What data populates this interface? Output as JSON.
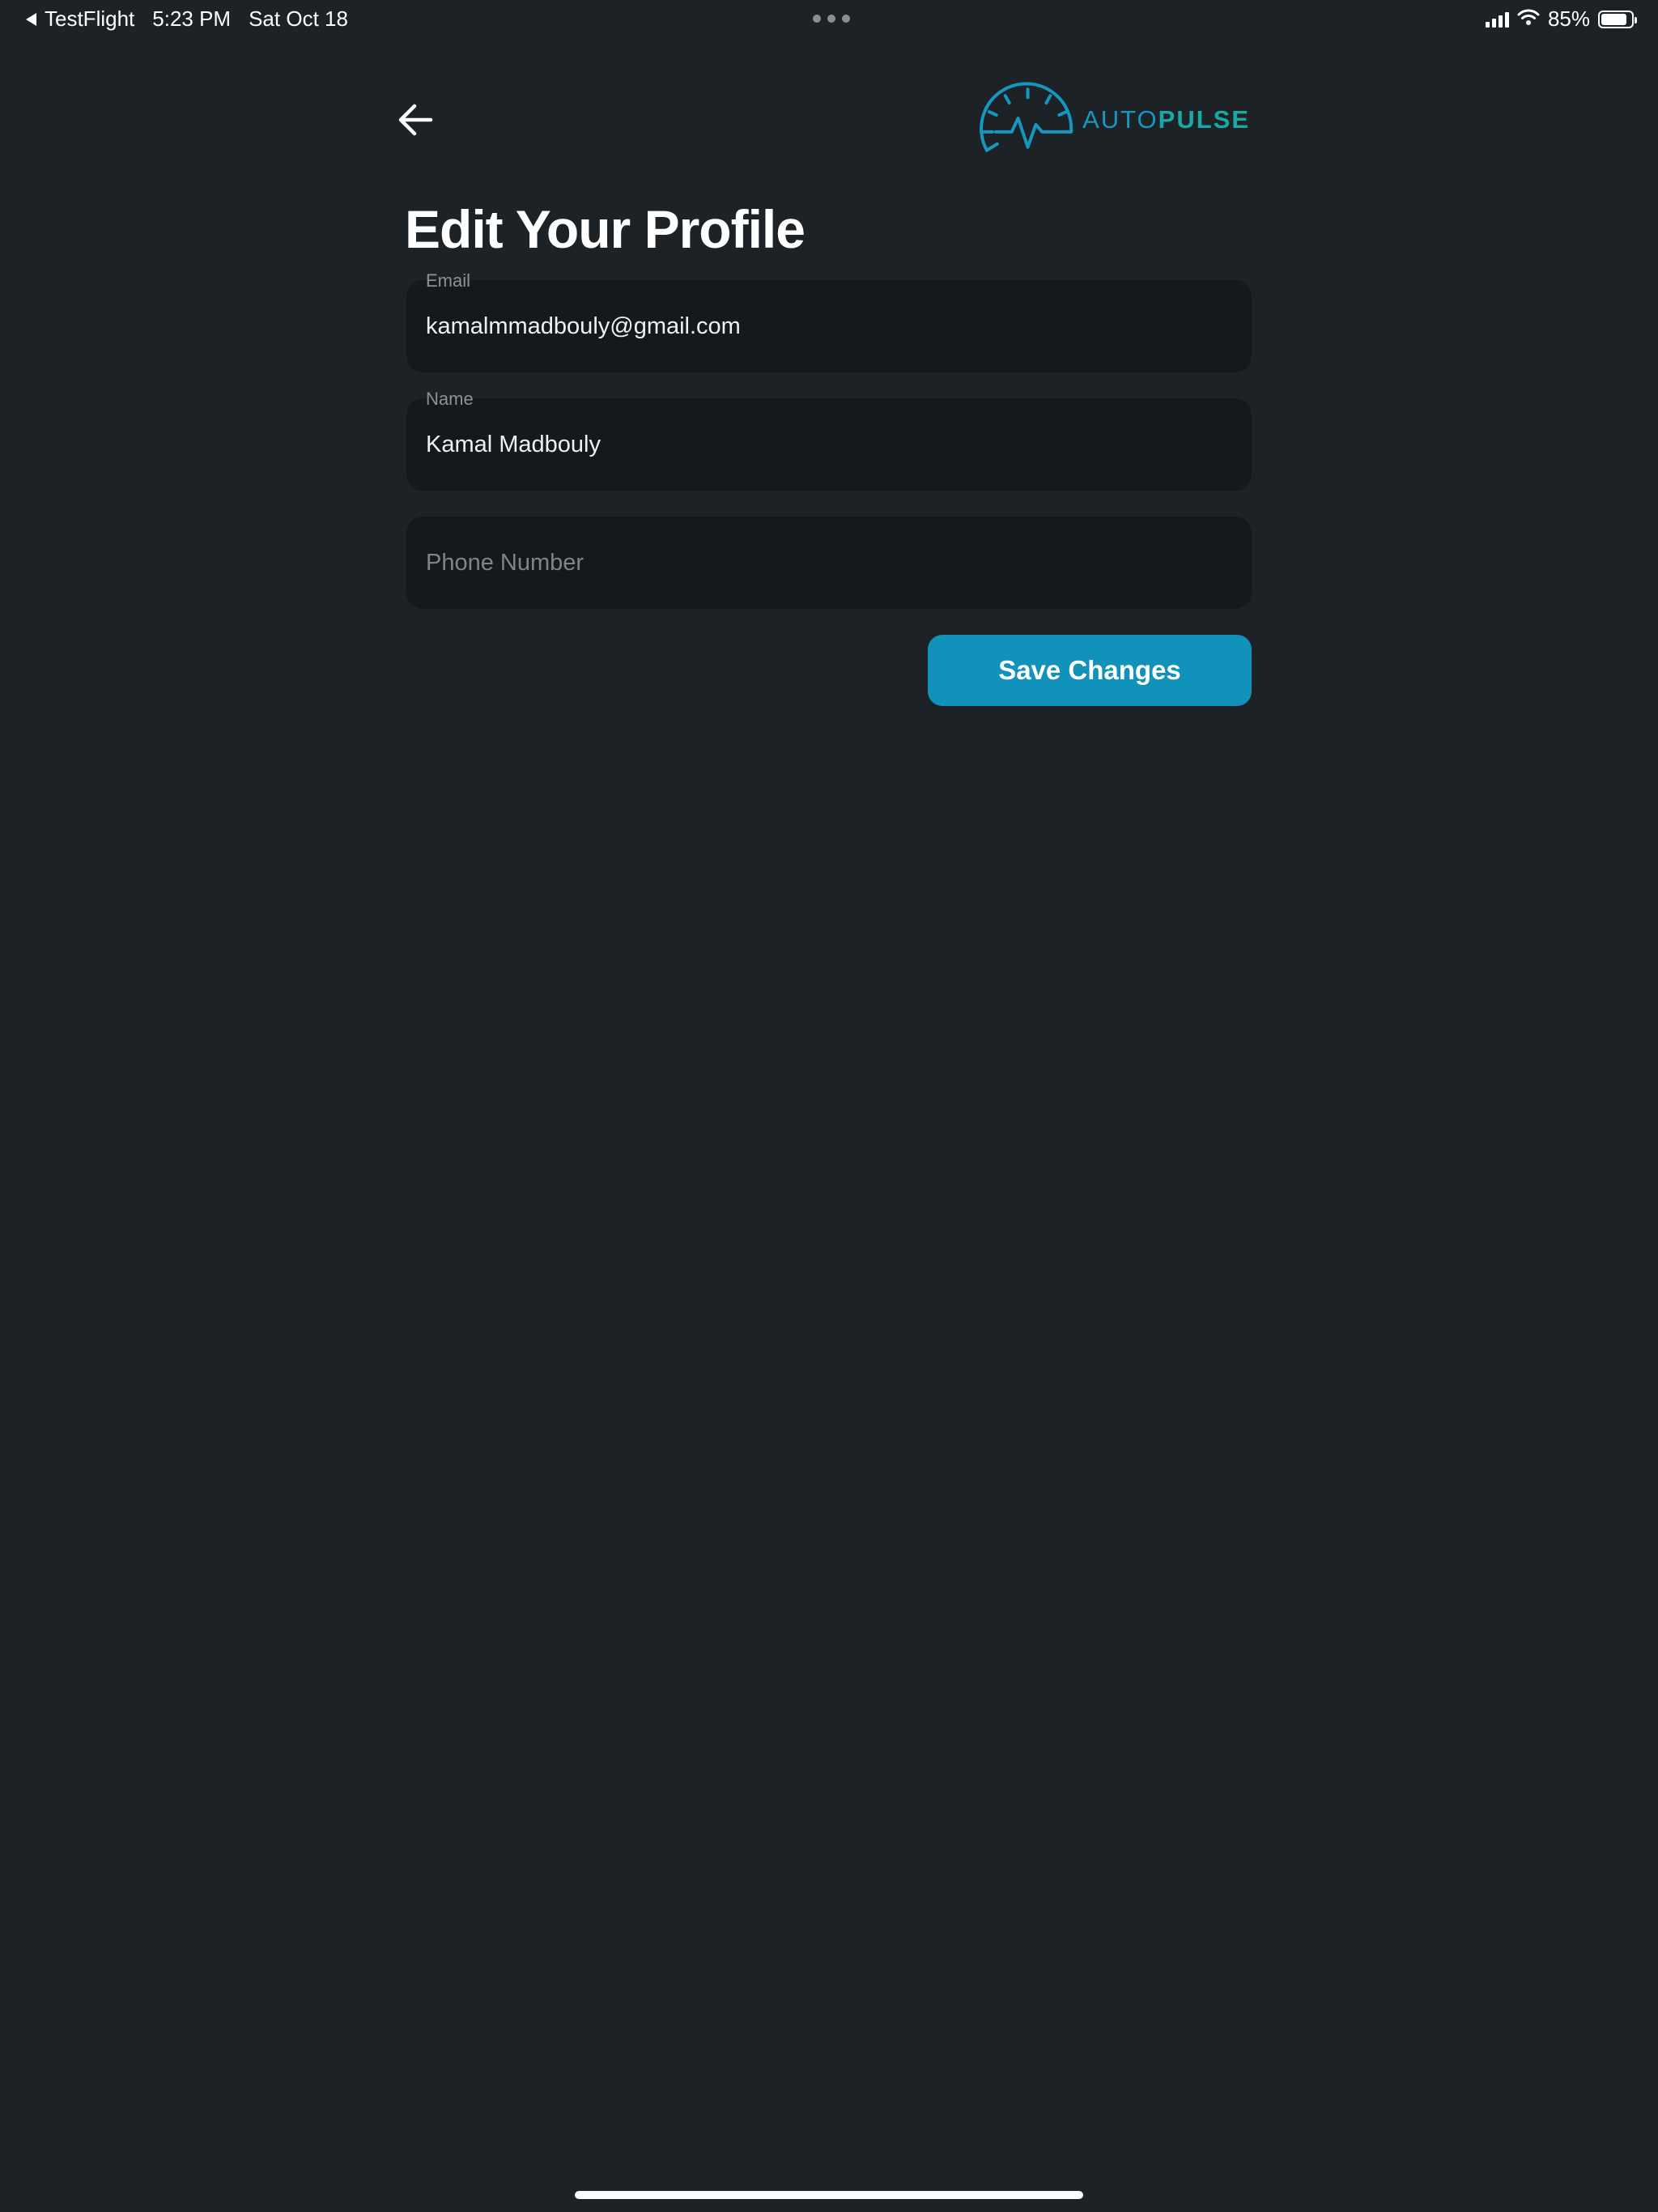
{
  "status_bar": {
    "back_app": "TestFlight",
    "time": "5:23 PM",
    "date": "Sat Oct 18",
    "battery_percent": "85%",
    "battery_level": 0.85,
    "icons": [
      "back-triangle-icon",
      "multitask-dots-icon",
      "cellular-signal-icon",
      "wifi-icon",
      "battery-icon"
    ]
  },
  "header": {
    "back_icon": "arrow-left-icon",
    "logo": {
      "word_light": "AUTO",
      "word_bold": "PULSE",
      "icon": "speedometer-pulse-icon"
    }
  },
  "page": {
    "title": "Edit Your Profile"
  },
  "form": {
    "email": {
      "label": "Email",
      "value": "kamalmmadbouly@gmail.com",
      "placeholder": ""
    },
    "name": {
      "label": "Name",
      "value": "Kamal Madbouly",
      "placeholder": ""
    },
    "phone": {
      "label": "",
      "value": "",
      "placeholder": "Phone Number"
    },
    "save_label": "Save Changes"
  },
  "colors": {
    "background": "#1c2226",
    "field_background": "#15191c",
    "accent": "#1192ba",
    "logo_teal": "#18a8a6",
    "logo_blue": "#1597bf"
  }
}
